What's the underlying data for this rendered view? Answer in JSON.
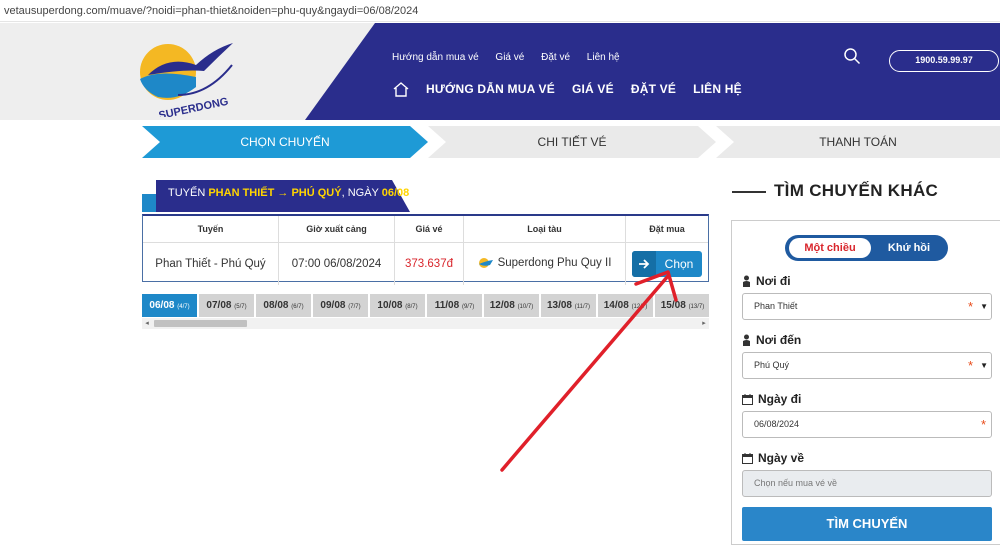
{
  "url": "vetausuperdong.com/muave/?noidi=phan-thiet&noiden=phu-quy&ngaydi=06/08/2024",
  "header": {
    "logo_text": "SUPERDONG",
    "top_menu": [
      "Hướng dẫn mua vé",
      "Giá vé",
      "Đặt vé",
      "Liên hệ"
    ],
    "main_menu": [
      "HƯỚNG DẪN MUA VÉ",
      "GIÁ VÉ",
      "ĐẶT VÉ",
      "LIÊN HỆ"
    ],
    "hotline": "1900.59.99.97"
  },
  "steps": [
    "CHỌN CHUYẾN",
    "CHI TIẾT VÉ",
    "THANH TOÁN"
  ],
  "route_title": {
    "prefix": "TUYẾN ",
    "from": "PHAN THIẾT",
    "arrow": " → ",
    "to": "PHÚ QUÝ",
    "date_prefix": ", NGÀY ",
    "date": "06/08"
  },
  "table": {
    "headers": [
      "Tuyến",
      "Giờ xuất cảng",
      "Giá vé",
      "Loại tàu",
      "Đặt mua"
    ],
    "row": {
      "route": "Phan Thiết - Phú Quý",
      "time": "07:00 06/08/2024",
      "price": "373.637đ",
      "boat": "Superdong Phu Quy II",
      "button": "Chọn"
    }
  },
  "dates": [
    {
      "d": "06/08",
      "l": "(4/7)",
      "active": true
    },
    {
      "d": "07/08",
      "l": "(5/7)"
    },
    {
      "d": "08/08",
      "l": "(6/7)"
    },
    {
      "d": "09/08",
      "l": "(7/7)"
    },
    {
      "d": "10/08",
      "l": "(8/7)"
    },
    {
      "d": "11/08",
      "l": "(9/7)"
    },
    {
      "d": "12/08",
      "l": "(10/7)"
    },
    {
      "d": "13/08",
      "l": "(11/7)"
    },
    {
      "d": "14/08",
      "l": "(12/7)"
    },
    {
      "d": "15/08",
      "l": "(13/7)"
    }
  ],
  "search_panel": {
    "title": "TÌM CHUYẾN KHÁC",
    "one_way": "Một chiều",
    "round_trip": "Khứ hồi",
    "from_label": "Nơi đi",
    "from_value": "Phan Thiết",
    "to_label": "Nơi đến",
    "to_value": "Phú Quý",
    "date_label": "Ngày đi",
    "date_value": "06/08/2024",
    "return_label": "Ngày về",
    "return_placeholder": "Chọn nếu mua vé về",
    "required_mark": "*",
    "button": "TÌM CHUYẾN"
  },
  "colors": {
    "navy": "#2a2d8c",
    "accent_blue": "#1e88c8",
    "price_red": "#d9262c",
    "annotation_red": "#e0202a"
  }
}
